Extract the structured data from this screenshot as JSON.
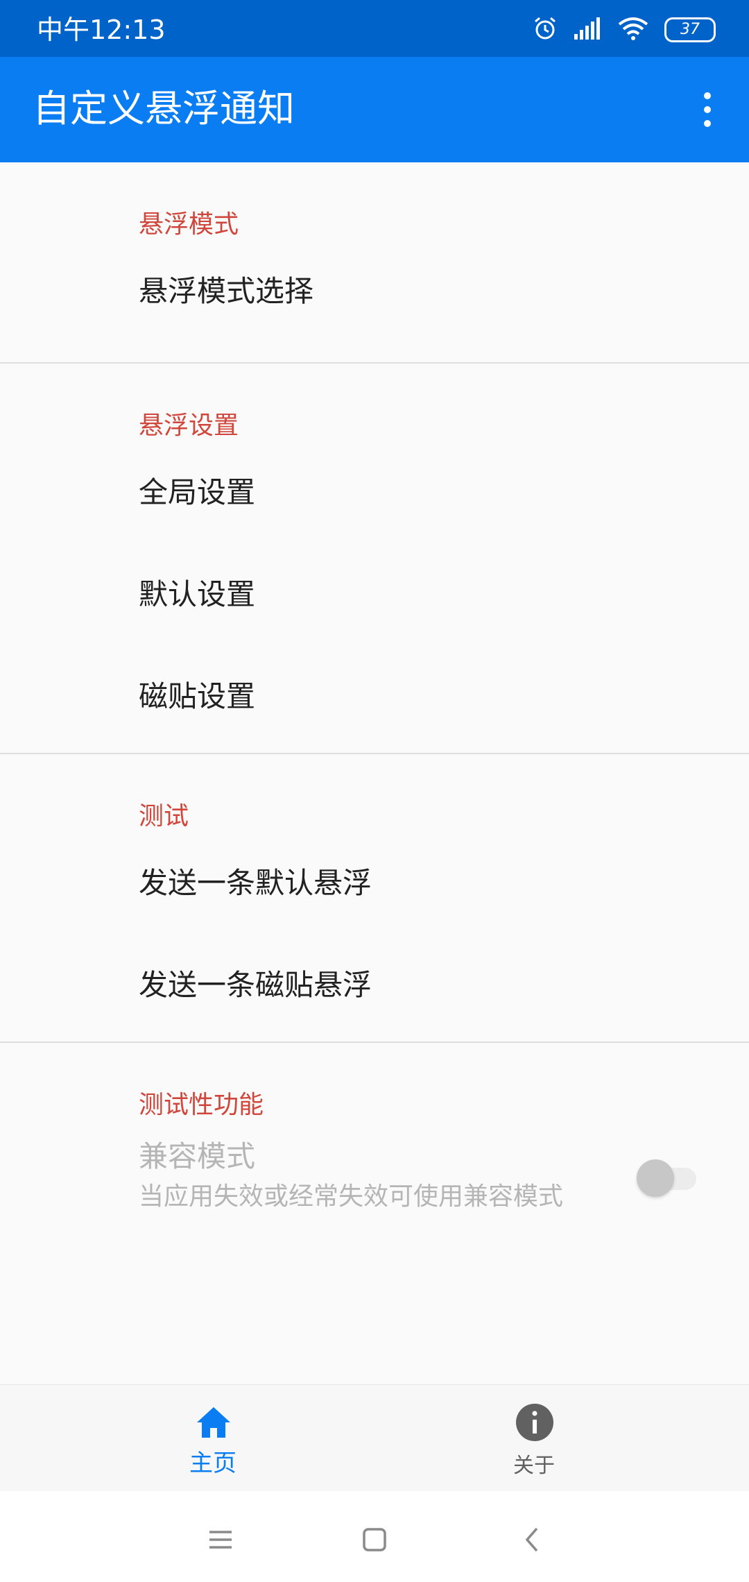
{
  "status_bar": {
    "time": "中午12:13",
    "battery": "37",
    "icons": [
      "alarm-icon",
      "signal-icon",
      "wifi-icon",
      "battery-icon"
    ]
  },
  "app_bar": {
    "title": "自定义悬浮通知",
    "menu_icon": "more-vert-icon"
  },
  "sections": {
    "float_mode": {
      "header": "悬浮模式",
      "items": {
        "select_mode": "悬浮模式选择"
      }
    },
    "float_settings": {
      "header": "悬浮设置",
      "items": {
        "global": "全局设置",
        "default": "默认设置",
        "tile": "磁贴设置"
      }
    },
    "test": {
      "header": "测试",
      "items": {
        "send_default": "发送一条默认悬浮",
        "send_tile": "发送一条磁贴悬浮"
      }
    },
    "experimental": {
      "header": "测试性功能",
      "compat_mode": {
        "title": "兼容模式",
        "summary": "当应用失效或经常失效可使用兼容模式",
        "enabled": false,
        "toggle_on": false
      }
    }
  },
  "bottom_nav": {
    "home": {
      "label": "主页",
      "icon": "home-icon",
      "selected": true
    },
    "about": {
      "label": "关于",
      "icon": "info-icon",
      "selected": false
    }
  },
  "system_nav": {
    "menu_icon": "menu-icon",
    "home_icon": "home-square-icon",
    "back_icon": "back-icon"
  },
  "colors": {
    "status_bar": "#0063c9",
    "app_bar": "#0a7df2",
    "section_header": "#d0463a",
    "accent": "#0a7df2",
    "disabled_text": "#b5b5b5"
  }
}
